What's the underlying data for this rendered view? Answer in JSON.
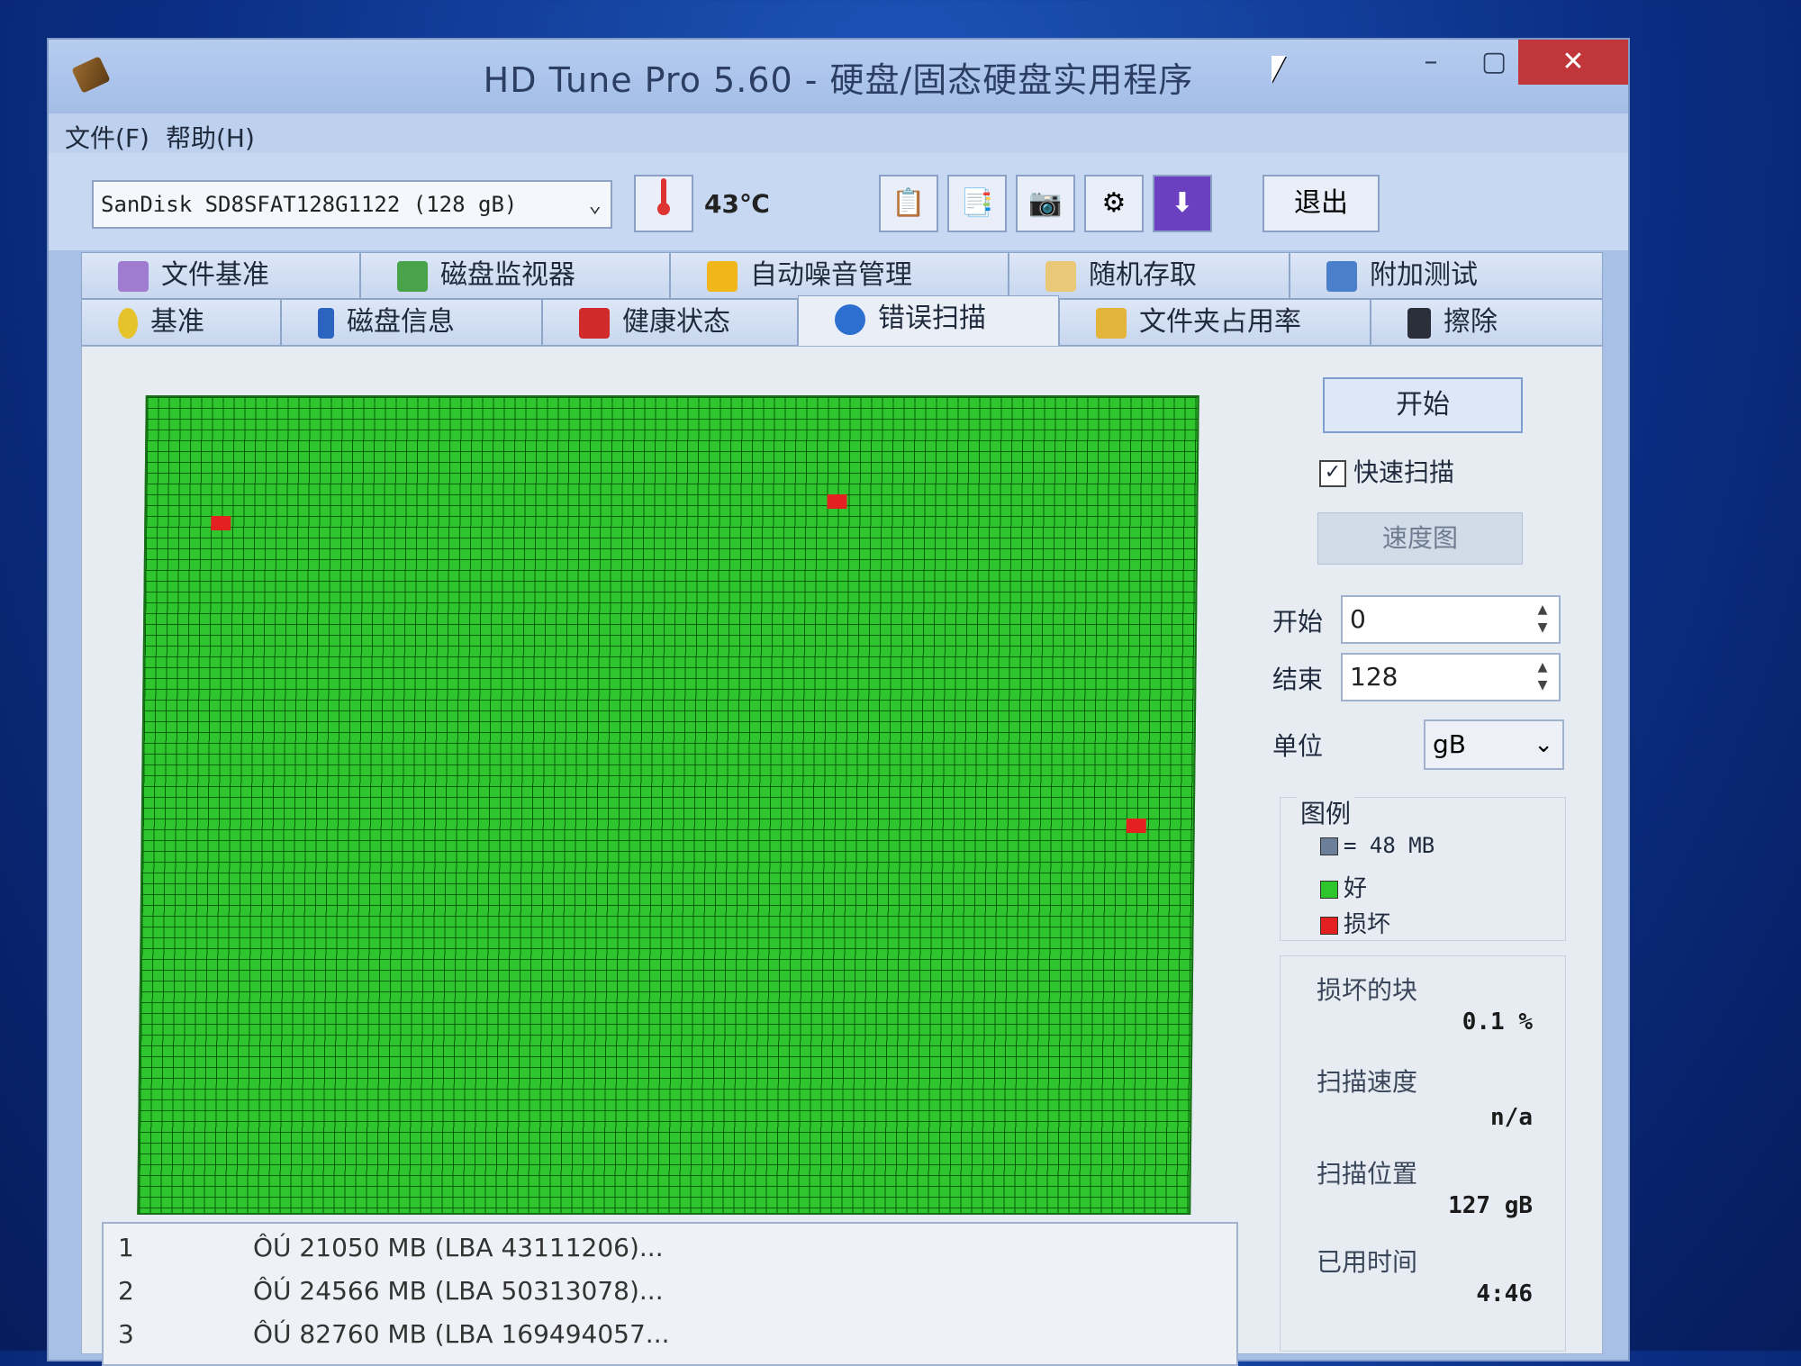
{
  "window": {
    "title": "HD Tune Pro 5.60 - 硬盘/固态硬盘实用程序",
    "controls": {
      "minimize": "–",
      "maximize": "▢",
      "close": "✕"
    }
  },
  "menu": {
    "file": "文件(F)",
    "help": "帮助(H)"
  },
  "toolbar": {
    "drive": "SanDisk SD8SFAT128G1122 (128 gB)",
    "temperature": "43℃",
    "exit_label": "退出"
  },
  "tabs_top": [
    "文件基准",
    "磁盘监视器",
    "自动噪音管理",
    "随机存取",
    "附加测试"
  ],
  "tabs_bottom": [
    "基准",
    "磁盘信息",
    "健康状态",
    "错误扫描",
    "文件夹占用率",
    "擦除"
  ],
  "active_tab": "错误扫描",
  "scan_map": {
    "bad_blocks": [
      {
        "col": 6,
        "row": 11
      },
      {
        "col": 63,
        "row": 9
      },
      {
        "col": 91,
        "row": 39
      }
    ]
  },
  "error_list": [
    {
      "index": "1",
      "text": "ÔÚ 21050 MB (LBA 43111206)..."
    },
    {
      "index": "2",
      "text": "ÔÚ 24566 MB (LBA 50313078)..."
    },
    {
      "index": "3",
      "text": "ÔÚ 82760 MB (LBA 169494057..."
    }
  ],
  "side": {
    "start_button": "开始",
    "quick_scan_label": "快速扫描",
    "quick_scan_checked": true,
    "speed_map_button": "速度图",
    "start_label": "开始",
    "start_value": "0",
    "end_label": "结束",
    "end_value": "128",
    "unit_label": "单位",
    "unit_value": "gB",
    "legend": {
      "title": "图例",
      "block_size": "= 48 MB",
      "good": "好",
      "damaged": "损坏"
    },
    "stats": {
      "damaged_blocks_label": "损坏的块",
      "damaged_blocks_value": "0.1 %",
      "scan_speed_label": "扫描速度",
      "scan_speed_value": "n/a",
      "scan_position_label": "扫描位置",
      "scan_position_value": "127 gB",
      "elapsed_label": "已用时间",
      "elapsed_value": "4:46"
    }
  },
  "colors": {
    "good": "#2fc52f",
    "damaged": "#e52020",
    "block": "#6b7f9a"
  }
}
